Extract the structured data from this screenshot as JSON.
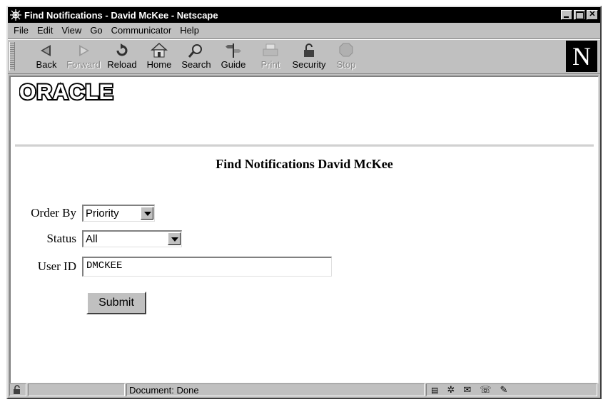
{
  "window": {
    "title": "Find Notifications - David McKee - Netscape"
  },
  "menu": [
    {
      "label": "File"
    },
    {
      "label": "Edit"
    },
    {
      "label": "View"
    },
    {
      "label": "Go"
    },
    {
      "label": "Communicator"
    },
    {
      "label": "Help"
    }
  ],
  "toolbar": {
    "back": "Back",
    "forward": "Forward",
    "reload": "Reload",
    "home": "Home",
    "search": "Search",
    "guide": "Guide",
    "print": "Print",
    "security": "Security",
    "stop": "Stop",
    "logo_letter": "N"
  },
  "page": {
    "logo_text": "ORACLE",
    "title": "Find Notifications David McKee",
    "order_by": {
      "label": "Order By",
      "value": "Priority"
    },
    "status": {
      "label": "Status",
      "value": "All"
    },
    "user_id": {
      "label": "User ID",
      "value": "DMCKEE"
    },
    "submit_label": "Submit"
  },
  "statusbar": {
    "text": "Document: Done"
  },
  "colors": {
    "chrome": "#c0c0c0",
    "titlebar": "#000000",
    "content_bg": "#ffffff"
  }
}
